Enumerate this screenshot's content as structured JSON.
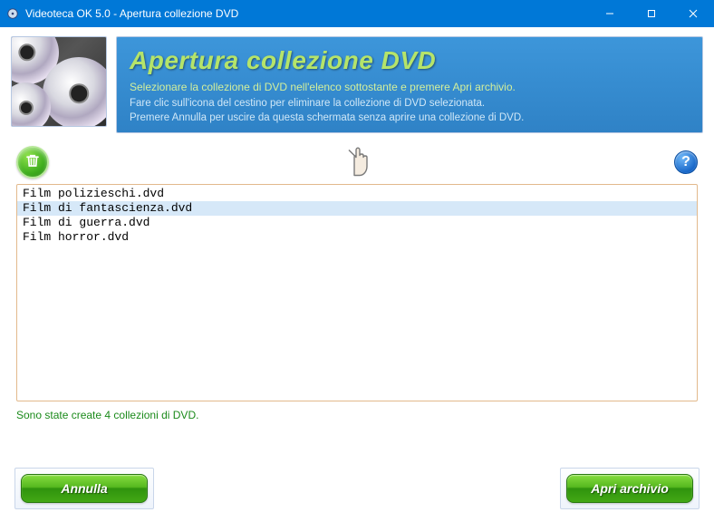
{
  "window": {
    "title": "Videoteca OK 5.0 - Apertura collezione DVD"
  },
  "banner": {
    "heading": "Apertura collezione DVD",
    "line1": "Selezionare la collezione di DVD nell'elenco sottostante e premere Apri archivio.",
    "line2": "Fare clic sull'icona del cestino per eliminare la collezione di DVD selezionata.",
    "line3": "Premere Annulla per uscire da questa schermata senza aprire una collezione di DVD."
  },
  "collections": {
    "items": [
      "Film polizieschi.dvd",
      "Film di fantascienza.dvd",
      "Film di guerra.dvd",
      "Film horror.dvd"
    ],
    "selected_index": 1
  },
  "status": "Sono state create 4 collezioni di DVD.",
  "buttons": {
    "cancel": "Annulla",
    "open": "Apri archivio"
  }
}
